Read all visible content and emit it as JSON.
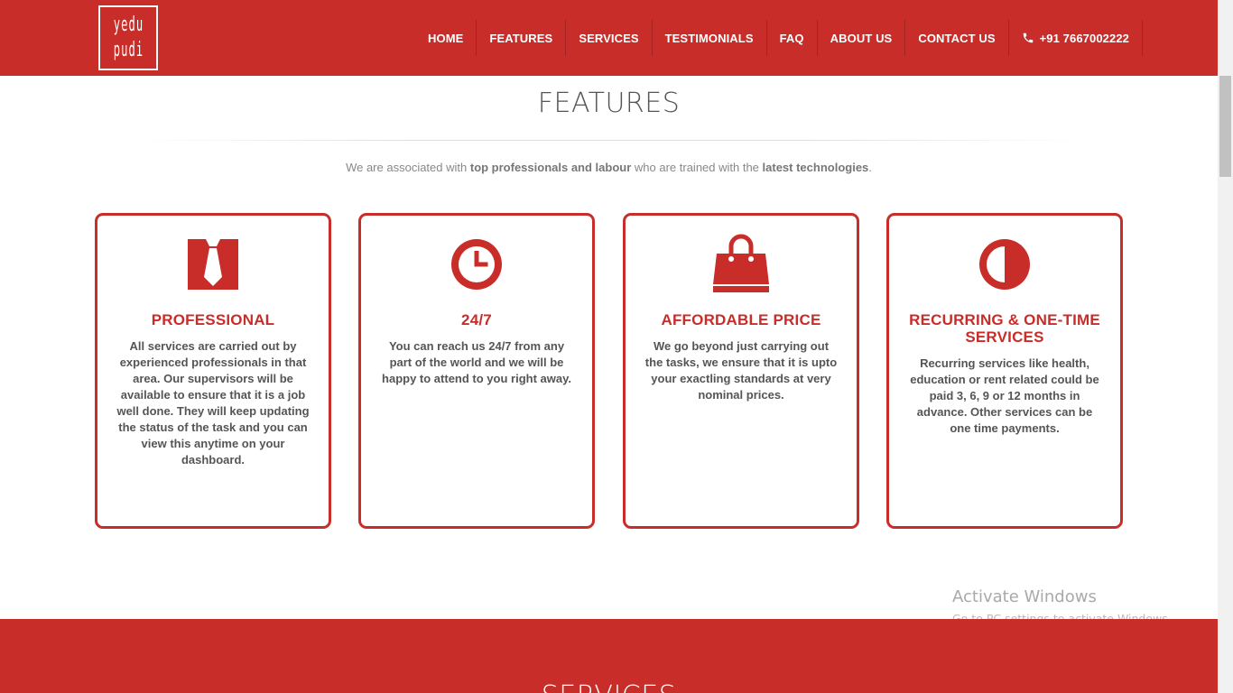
{
  "brand": {
    "logo_line1": "yedu",
    "logo_line2": "pudi"
  },
  "nav": {
    "items": [
      {
        "label": "HOME"
      },
      {
        "label": "FEATURES"
      },
      {
        "label": "SERVICES"
      },
      {
        "label": "TESTIMONIALS"
      },
      {
        "label": "FAQ"
      },
      {
        "label": "ABOUT US"
      },
      {
        "label": "CONTACT US"
      }
    ],
    "active": "FEATURES",
    "phone": "+91 7667002222",
    "phone_icon": "phone-icon"
  },
  "features": {
    "title": "FEATURES",
    "subtitle_part1": "We are associated with ",
    "subtitle_bold1": "top professionals and labour",
    "subtitle_part2": " who are trained with the ",
    "subtitle_bold2": "latest technologies",
    "subtitle_part3": ".",
    "cards": [
      {
        "icon": "tie-icon",
        "title": "PROFESSIONAL",
        "text": "All services are carried out by experienced professionals in that area. Our supervisors will be available to ensure that it is a job well done. They will keep updating the status of the task and you can view this anytime on your dashboard."
      },
      {
        "icon": "clock-icon",
        "title": "24/7",
        "text": "You can reach us 24/7 from any part of the world and we will be happy to attend to you right away."
      },
      {
        "icon": "shopping-bag-icon",
        "title": "AFFORDABLE PRICE",
        "text": "We go beyond just carrying out the tasks, we ensure that it is upto your exactling standards at very nominal prices."
      },
      {
        "icon": "half-circle-icon",
        "title": "RECURRING & ONE-TIME SERVICES",
        "text": "Recurring services like health, education or rent related could be paid 3, 6, 9 or 12 months in advance. Other services can be one time payments."
      }
    ]
  },
  "services": {
    "title": "SERVICES"
  },
  "watermark": {
    "title": "Activate Windows",
    "subtitle": "Go to PC settings to activate Windows."
  },
  "colors": {
    "brand_red": "#c82d29",
    "text_gray": "#555555"
  }
}
